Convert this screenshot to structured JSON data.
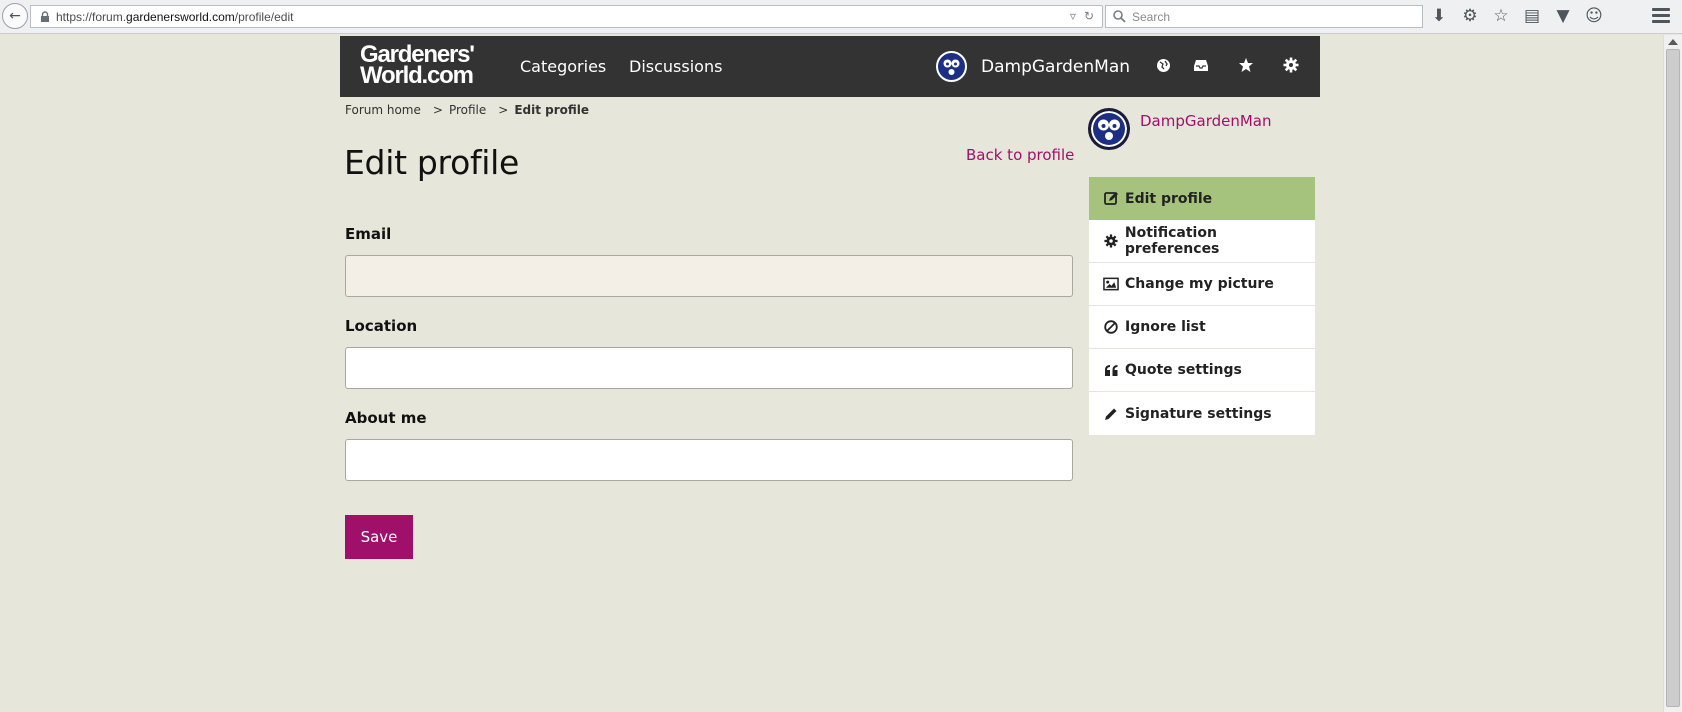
{
  "browser": {
    "url_prefix": "https://forum.",
    "url_domain": "gardenersworld.com",
    "url_path": "/profile/edit",
    "search_placeholder": "Search"
  },
  "header": {
    "logo_line1": "Gardeners'",
    "logo_line2": "World.com",
    "nav": [
      "Categories",
      "Discussions"
    ],
    "username": "DampGardenMan"
  },
  "breadcrumb": {
    "items": [
      "Forum home",
      "Profile"
    ],
    "separators": [
      ">",
      ">"
    ],
    "current": "Edit profile"
  },
  "page": {
    "title": "Edit profile",
    "back_link": "Back to profile"
  },
  "form": {
    "email_label": "Email",
    "email_value": "",
    "location_label": "Location",
    "location_value": "",
    "about_label": "About me",
    "about_value": "",
    "save_label": "Save"
  },
  "sidebar": {
    "username": "DampGardenMan",
    "menu": [
      {
        "label": "Edit profile",
        "icon": "edit-icon"
      },
      {
        "label": "Notification preferences",
        "icon": "gear-icon"
      },
      {
        "label": "Change my picture",
        "icon": "image-icon"
      },
      {
        "label": "Ignore list",
        "icon": "ban-icon"
      },
      {
        "label": "Quote settings",
        "icon": "quote-icon"
      },
      {
        "label": "Signature settings",
        "icon": "pencil-icon"
      }
    ]
  },
  "colors": {
    "page_bg": "#e7e6da",
    "header_bg": "#333333",
    "accent": "#a0106b",
    "active_menu": "#a6c37d"
  }
}
